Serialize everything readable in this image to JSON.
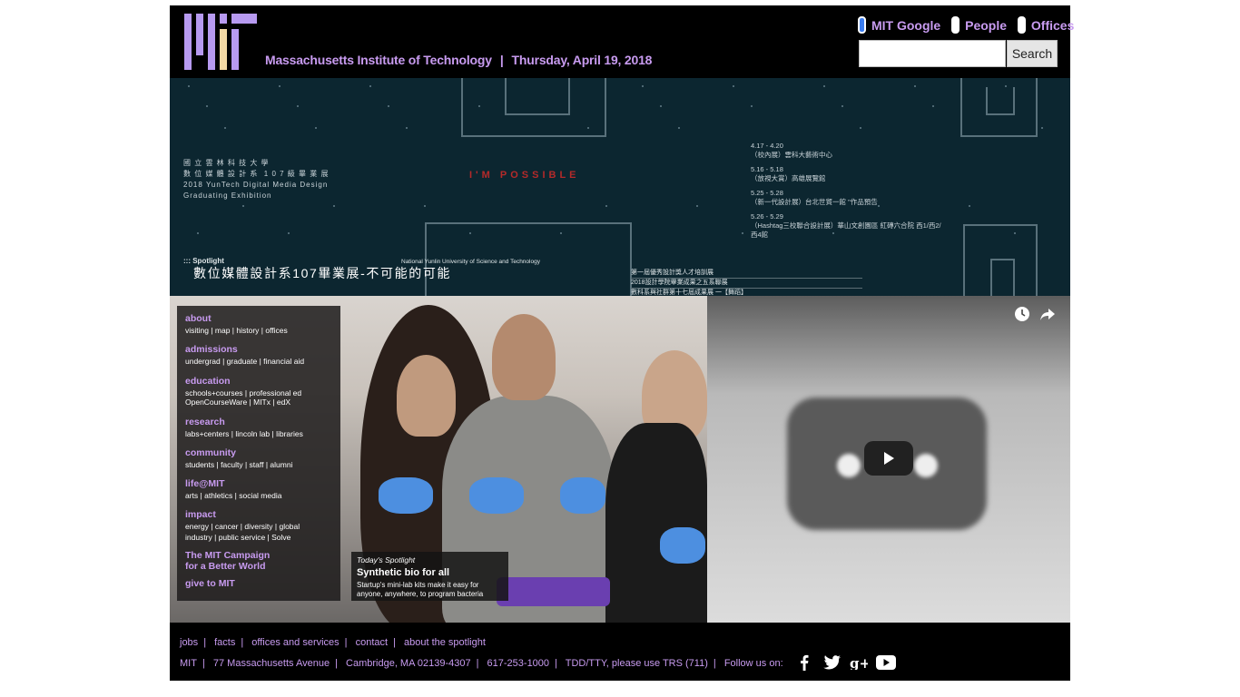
{
  "header": {
    "org_name": "Massachusetts Institute of Technology",
    "date": "Thursday, April 19, 2018",
    "search_options": [
      {
        "label": "MIT Google",
        "selected": true
      },
      {
        "label": "People",
        "selected": false
      },
      {
        "label": "Offices",
        "selected": false
      }
    ],
    "search_input_value": "",
    "search_button": "Search"
  },
  "banner": {
    "org_lines": "國 立 雲 林 科 技 大 學\n數 位 媒 體 設 計 系  1 0 7 級 畢 業 展\n2018 YunTech Digital Media Design\nGraduating Exhibition",
    "impossible": "I'M  POSSIBLE",
    "dates": [
      {
        "range": "4.17 - 4.20",
        "place": "（校內展）雲科大藝術中心"
      },
      {
        "range": "5.16 - 5.18",
        "place": "（放視大賞）高雄展覽館"
      },
      {
        "range": "5.25 - 5.28",
        "place": "（新一代設計展）台北世貿一館 \"作品預告"
      },
      {
        "range": "5.26 - 5.29",
        "place": "（Hashtag三校聯合設計展）華山文創園區 紅磚六合院 西1/西2/西4館"
      }
    ],
    "university": "National Yunlin University of Science and Technology",
    "spotlight_tag": "::: Spotlight",
    "title": "數位媒體設計系107畢業展-不可能的可能",
    "events": [
      "第一屆優秀設計獎人才培訓展",
      "2018設計學院畢業成果之五系聯展",
      "數科系與社群第十七屆成果展 一【舞蹈】"
    ]
  },
  "nav": [
    {
      "heading": "about",
      "links": [
        "visiting | map | history | offices"
      ]
    },
    {
      "heading": "admissions",
      "links": [
        "undergrad | graduate | financial aid"
      ]
    },
    {
      "heading": "education",
      "links": [
        "schools+courses | professional ed",
        "OpenCourseWare | MITx | edX"
      ]
    },
    {
      "heading": "research",
      "links": [
        "labs+centers | lincoln lab | libraries"
      ]
    },
    {
      "heading": "community",
      "links": [
        "students | faculty | staff | alumni"
      ]
    },
    {
      "heading": "life@MIT",
      "links": [
        "arts | athletics | social media"
      ]
    },
    {
      "heading": "impact",
      "links": [
        "energy | cancer | diversity | global",
        "industry | public service | Solve"
      ]
    },
    {
      "heading": "The MIT Campaign",
      "links": []
    },
    {
      "heading": "for a Better World",
      "links": []
    },
    {
      "heading": "give to MIT",
      "links": []
    }
  ],
  "today_spotlight": {
    "tag": "Today's Spotlight",
    "title": "Synthetic bio for all",
    "desc_line1": "Startup's mini-lab kits make it easy for",
    "desc_line2": "anyone, anywhere, to program bacteria"
  },
  "video": {
    "icons": [
      "clock-icon",
      "share-icon",
      "play-icon"
    ]
  },
  "footer": {
    "row1": [
      "jobs",
      "facts",
      "offices and services",
      "contact",
      "about the spotlight"
    ],
    "row2": [
      "MIT",
      "77 Massachusetts Avenue",
      "Cambridge, MA 02139-4307",
      "617-253-1000",
      "TDD/TTY, please use TRS (711)",
      "Follow us on:"
    ],
    "social": [
      "facebook-icon",
      "twitter-icon",
      "google-plus-icon",
      "youtube-icon"
    ]
  },
  "colors": {
    "accent": "#c89bf0",
    "logo_purple": "#b79af0",
    "logo_cream": "#f3d9a4",
    "banner_bg": "#0c2630"
  }
}
